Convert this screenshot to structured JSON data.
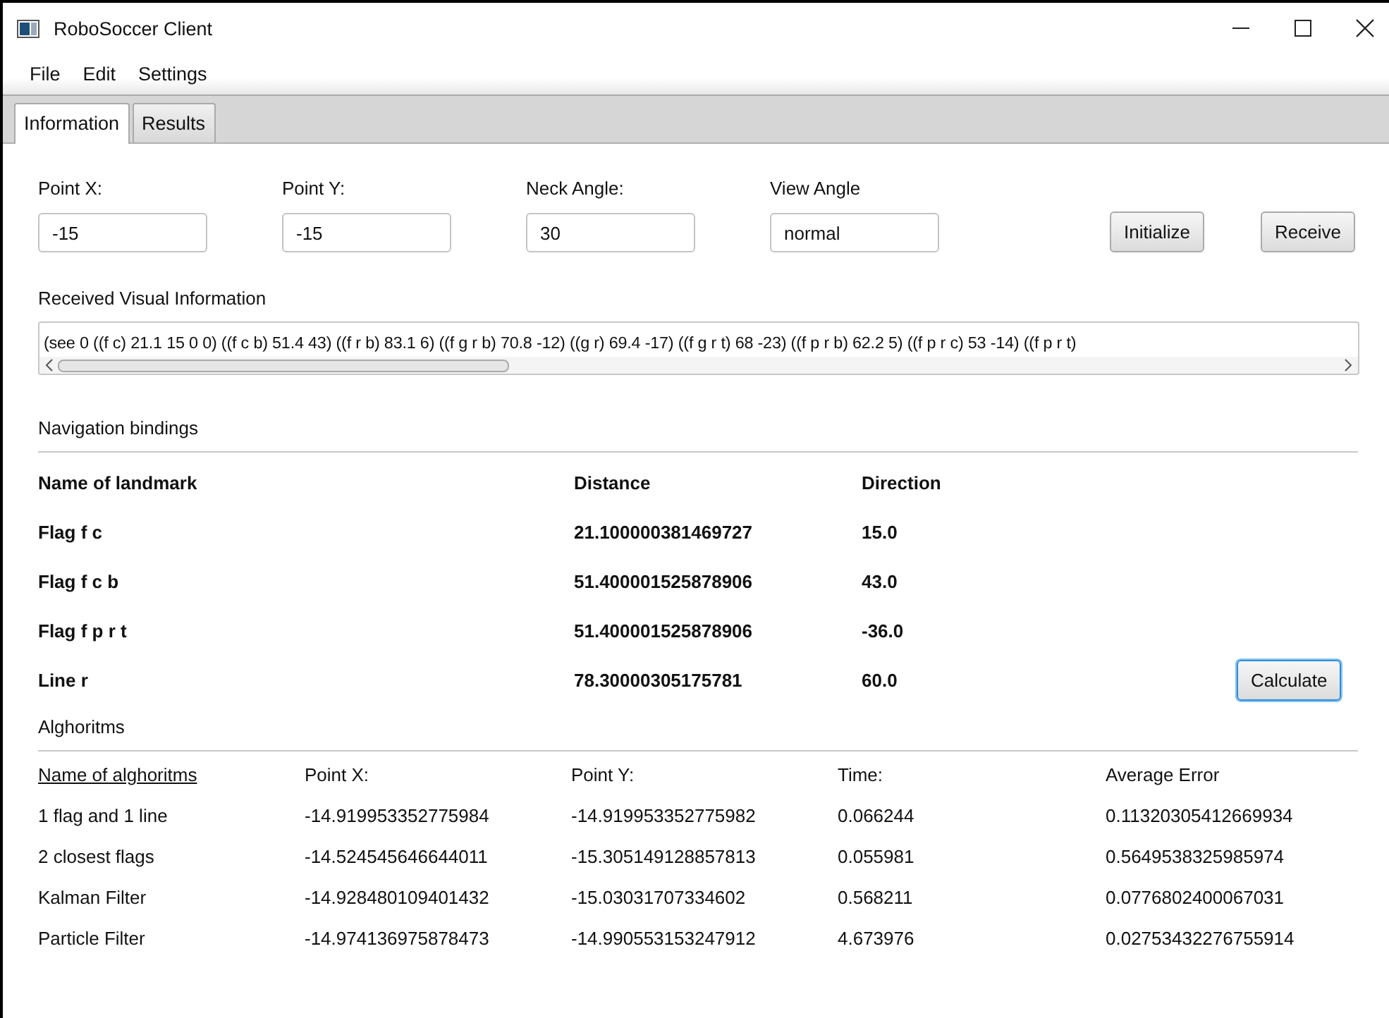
{
  "window": {
    "title": "RoboSoccer Client"
  },
  "menu": [
    "File",
    "Edit",
    "Settings"
  ],
  "tabs": [
    {
      "label": "Information",
      "selected": true
    },
    {
      "label": "Results",
      "selected": false
    }
  ],
  "inputs": [
    {
      "label": "Point X:",
      "value": "-15"
    },
    {
      "label": "Point Y:",
      "value": "-15"
    },
    {
      "label": "Neck Angle:",
      "value": "30"
    },
    {
      "label": "View Angle",
      "value": "normal"
    }
  ],
  "buttons": [
    "Initialize",
    "Receive"
  ],
  "visual_info": {
    "label": "Received Visual Information",
    "value": "(see 0 ((f c) 21.1 15 0 0) ((f c b) 51.4 43) ((f r b) 83.1 6) ((f g r b) 70.8 -12) ((g r) 69.4 -17) ((f g r t) 68 -23) ((f p r b) 62.2 5) ((f p r c) 53 -14) ((f p r t)"
  },
  "navigation": {
    "title": "Navigation bindings",
    "columns": [
      "Name of landmark",
      "Distance",
      "Direction"
    ],
    "rows": [
      [
        "Flag f c",
        "21.100000381469727",
        "15.0"
      ],
      [
        "Flag f c b",
        "51.400001525878906",
        "43.0"
      ],
      [
        "Flag f p r t",
        "51.400001525878906",
        "-36.0"
      ],
      [
        "Line r",
        "78.30000305175781",
        "60.0"
      ]
    ],
    "button": {
      "label": "Calculate",
      "focused": true
    }
  },
  "algorithms": {
    "title": "Alghoritms",
    "columns": [
      "Name of alghoritms",
      "Point X:",
      "Point Y:",
      "Time:",
      "Average Error"
    ],
    "rows": [
      [
        "1 flag and 1 line",
        "-14.919953352775984",
        "-14.919953352775982",
        "0.066244",
        "0.11320305412669934"
      ],
      [
        "2 closest flags",
        "-14.524545646644011",
        "-15.305149128857813",
        "0.055981",
        "0.5649538325985974"
      ],
      [
        "Kalman Filter",
        "-14.928480109401432",
        "-15.03031707334602",
        "0.568211",
        "0.0776802400067031"
      ],
      [
        "Particle Filter",
        "-14.974136975878473",
        "-14.990553153247912",
        "4.673976",
        "0.02753432276755914"
      ]
    ]
  }
}
